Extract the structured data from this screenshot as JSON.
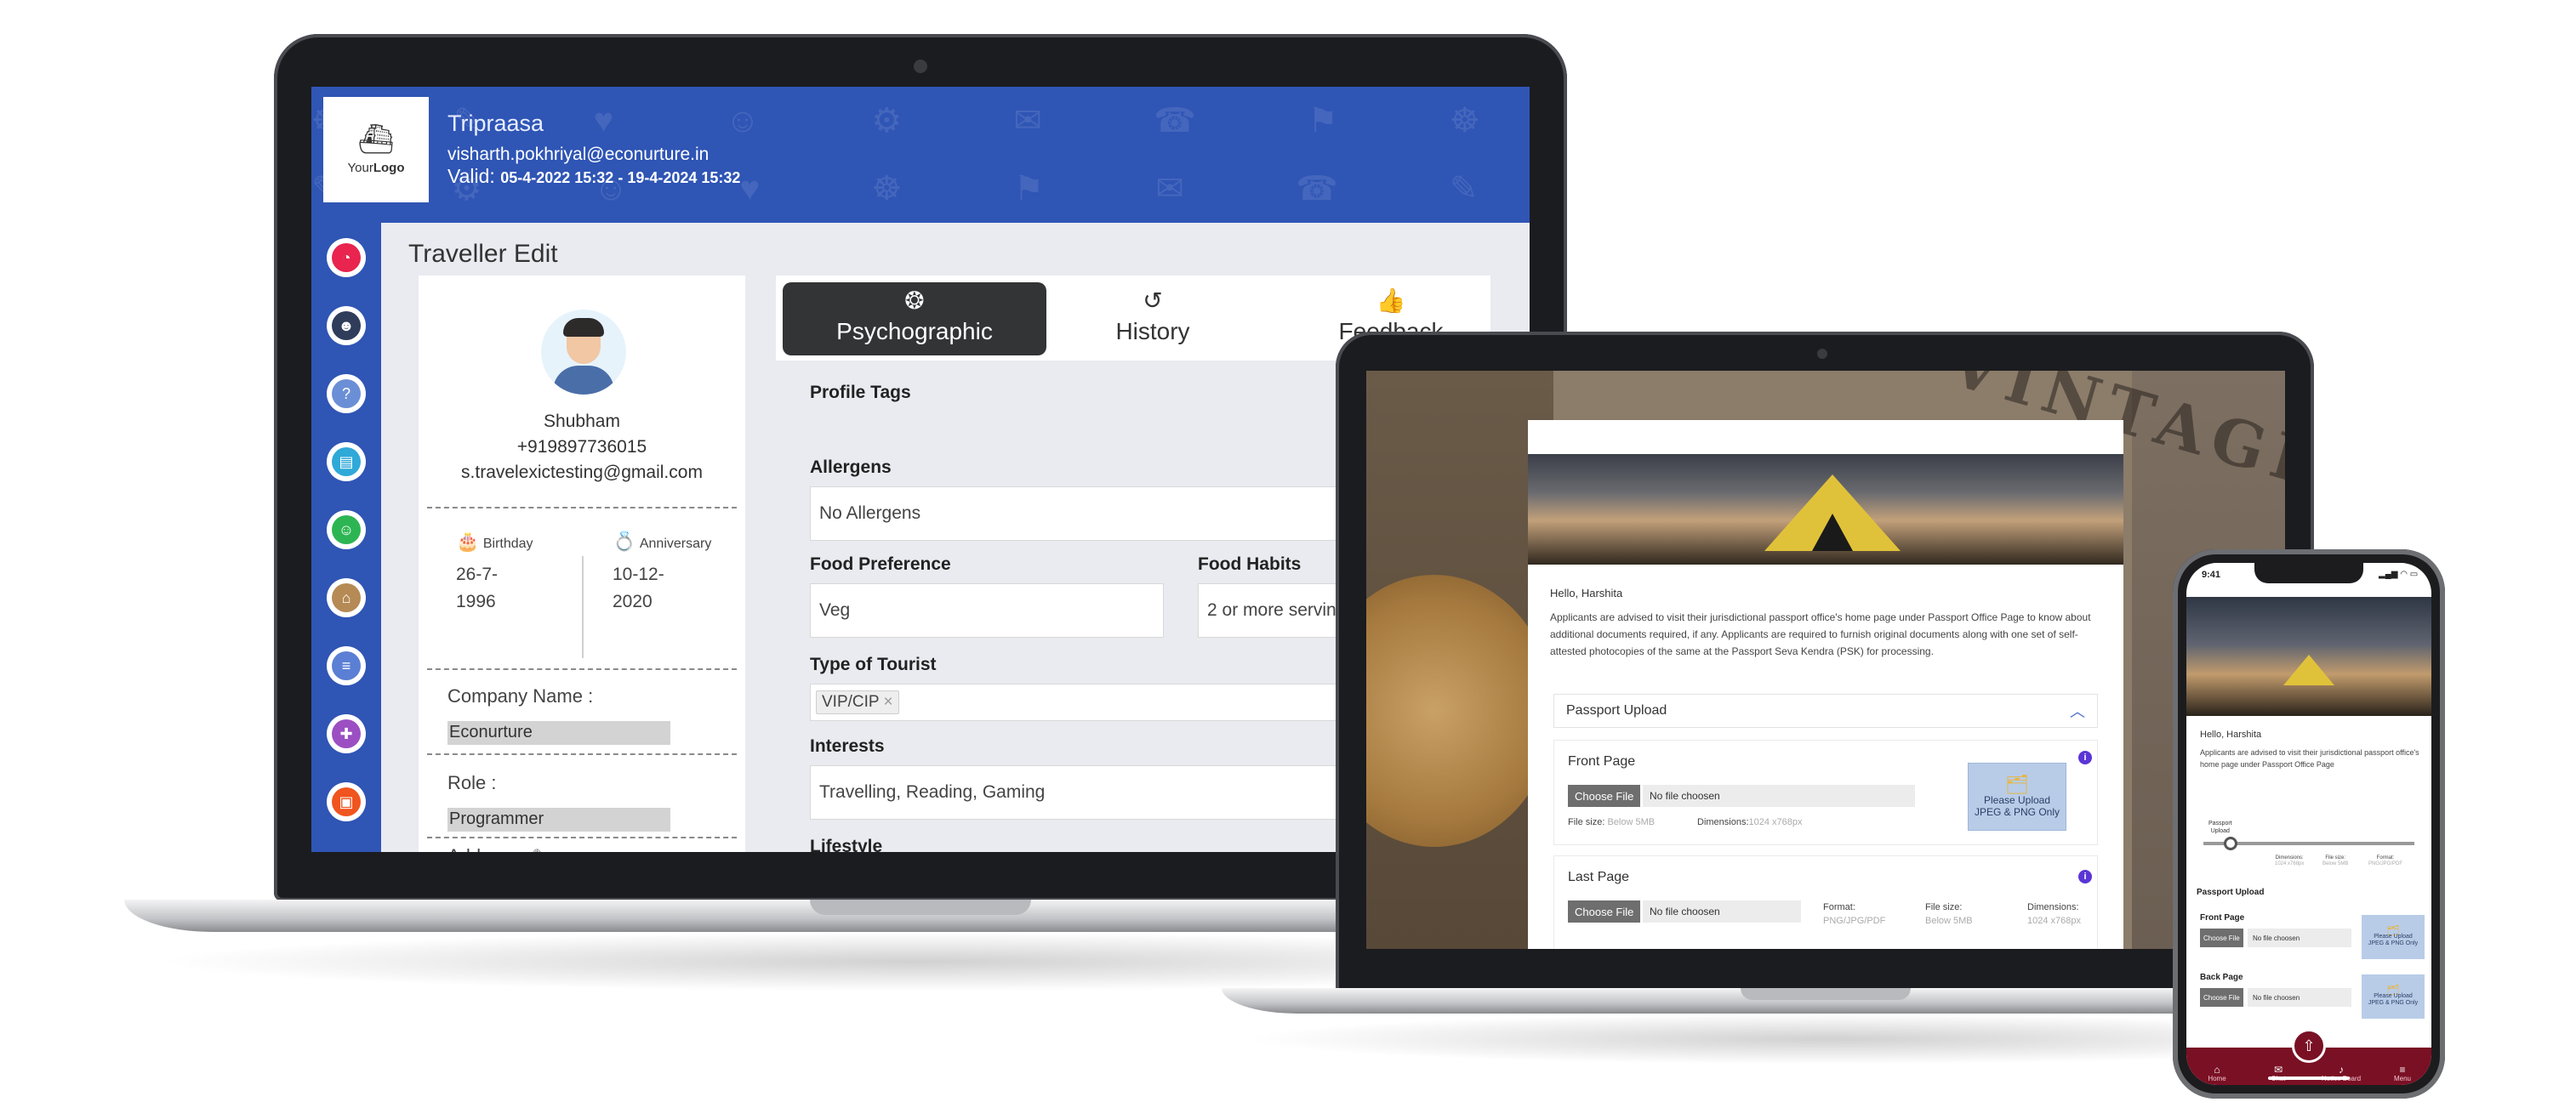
{
  "big_app": {
    "logo": {
      "text_prefix": "Your",
      "text_bold": "Logo"
    },
    "header": {
      "title": "Tripraasa",
      "email": "visharth.pokhriyal@econurture.in",
      "valid_label": "Valid:",
      "valid_dates": "05-4-2022 15:32 - 19-4-2024 15:32"
    },
    "sidebar_icons": [
      {
        "icon": "speedometer-icon",
        "color": "#e8244f"
      },
      {
        "icon": "user-settings-icon",
        "color": "#2f3d5a"
      },
      {
        "icon": "help-icon",
        "color": "#6b8fd6"
      },
      {
        "icon": "passport-icon",
        "color": "#2fa9d8"
      },
      {
        "icon": "group-icon",
        "color": "#2db553"
      },
      {
        "icon": "hotel-icon",
        "color": "#b58a55"
      },
      {
        "icon": "list-icon",
        "color": "#5b7fd4"
      },
      {
        "icon": "gift-icon",
        "color": "#9b4fc2"
      },
      {
        "icon": "luggage-icon",
        "color": "#f0541f"
      }
    ],
    "page_title": "Traveller Edit",
    "profile": {
      "name": "Shubham",
      "phone": "+919897736015",
      "email": "s.travelexictesting@gmail.com",
      "birthday_label": "Birthday",
      "birthday_line1": "26-7-",
      "birthday_line2": "1996",
      "anniversary_label": "Anniversary",
      "anniversary_line1": "10-12-",
      "anniversary_line2": "2020",
      "company_label": "Company Name :",
      "company_value": "Econurture",
      "role_label": "Role :",
      "role_value": "Programmer",
      "address_label": "Address :"
    },
    "tabs": [
      {
        "label": "Psychographic",
        "icon": "brain-icon",
        "active": true
      },
      {
        "label": "History",
        "icon": "history-icon",
        "active": false
      },
      {
        "label": "Feedback",
        "icon": "thumbs-up-icon",
        "active": false
      }
    ],
    "form": {
      "profile_tags_label": "Profile Tags",
      "allergens_label": "Allergens",
      "allergens_value": "No Allergens",
      "food_pref_label": "Food Preference",
      "food_pref_value": "Veg",
      "food_habits_label": "Food Habits",
      "food_habits_value": "2 or more servin",
      "tourist_type_label": "Type of Tourist",
      "tourist_chip": "VIP/CIP",
      "interests_label": "Interests",
      "interests_value": "Travelling, Reading, Gaming",
      "lifestyle_label": "Lifestyle"
    }
  },
  "laptop2_app": {
    "background_text": "VINTAGE",
    "greeting": "Hello, Harshita",
    "body": "Applicants are advised to visit their jurisdictional passport office's home page under Passport Office Page to know about additional documents required, if any. Applicants are required to furnish original documents along with one set of self-attested photocopies of the same at the Passport Seva Kendra (PSK) for processing.",
    "accordion_title": "Passport Upload",
    "front": {
      "title": "Front Page",
      "choose": "Choose File",
      "no_file": "No file choosen",
      "size_label": "File size:",
      "size_value": "Below 5MB",
      "dim_label": "Dimensions:",
      "dim_value": "1024 x768px",
      "upload_line1": "Please Upload",
      "upload_line2": "JPEG & PNG Only"
    },
    "last": {
      "title": "Last Page",
      "choose": "Choose File",
      "no_file": "No file choosen",
      "format_label": "Format:",
      "format_value": "PNG/JPG/PDF",
      "size_label": "File size:",
      "size_value": "Below 5MB",
      "dim_label": "Dimensions:",
      "dim_value": "1024 x768px"
    }
  },
  "phone_app": {
    "time": "9:41",
    "greeting": "Hello, Harshita",
    "text": "Applicants are advised to visit their jurisdictional passport office's home page under Passport Office Page",
    "step_label_1": "Passport",
    "step_label_2": "Upload",
    "meta": [
      {
        "label": "Dimensions:",
        "value": "1024 x768px"
      },
      {
        "label": "File size:",
        "value": "Below 5MB"
      },
      {
        "label": "Format:",
        "value": "PNG/JPG/PDF"
      }
    ],
    "section_title": "Passport Upload",
    "front_title": "Front Page",
    "back_title": "Back Page",
    "choose": "Choose File",
    "no_file": "No file choosen",
    "upload_line1": "Please Upload",
    "upload_line2": "JPEG & PNG Only",
    "nav": [
      "Home",
      "Chat",
      "Notice Board",
      "Menu"
    ]
  }
}
